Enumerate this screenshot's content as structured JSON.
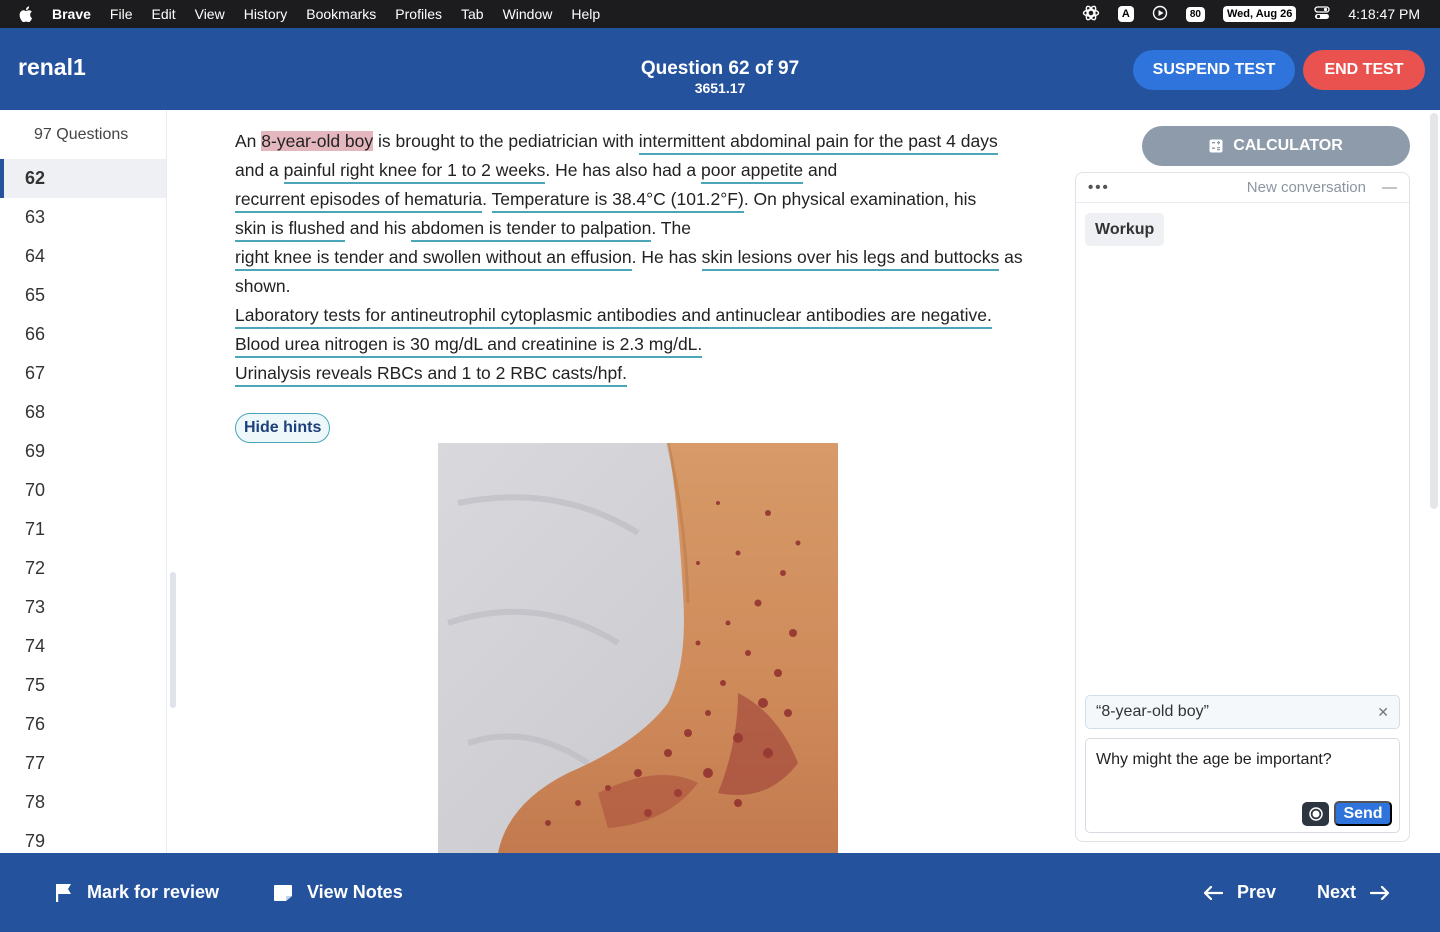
{
  "menubar": {
    "app": "Brave",
    "items": [
      "File",
      "Edit",
      "View",
      "History",
      "Bookmarks",
      "Profiles",
      "Tab",
      "Window",
      "Help"
    ],
    "input_indicator": "A",
    "battery": "80",
    "date": "Wed, Aug 26",
    "time": "4:18:47 PM"
  },
  "header": {
    "title": "renal1",
    "question_label": "Question 62 of 97",
    "timer": "3651.17",
    "suspend_label": "SUSPEND TEST",
    "end_label": "END TEST"
  },
  "sidebar": {
    "count_label": "97 Questions",
    "active": "62",
    "items": [
      "62",
      "63",
      "64",
      "65",
      "66",
      "67",
      "68",
      "69",
      "70",
      "71",
      "72",
      "73",
      "74",
      "75",
      "76",
      "77",
      "78",
      "79"
    ]
  },
  "question": {
    "l1": {
      "a": "An ",
      "hl": "8-year-old boy",
      "b": " is brought to the pediatrician with ",
      "u1": "intermittent abdominal pain for the past 4 days"
    },
    "l2": {
      "a": "and a ",
      "u1": "painful right knee for 1 to 2 weeks",
      "b": ". He has also had a ",
      "u2": "poor appetite",
      "c": " and"
    },
    "l3": {
      "u1": "recurrent episodes of hematuria",
      "a": ". ",
      "u2": "Temperature is 38.4°C (101.2°F)",
      "b": ". On physical examination, his"
    },
    "l4": {
      "u1": "skin is flushed",
      "a": " and his ",
      "u2": "abdomen is tender to palpation",
      "b": ". The"
    },
    "l5": {
      "u1": "right knee is tender and swollen without an effusion",
      "a": ". He has ",
      "u2": "skin lesions over his legs and buttocks",
      "b": " as"
    },
    "l6": "shown.",
    "l7": "Laboratory tests for antineutrophil cytoplasmic antibodies and antinuclear antibodies are negative.",
    "l8": "Blood urea nitrogen is 30 mg/dL and creatinine is 2.3 mg/dL.",
    "l9": "Urinalysis reveals RBCs and 1 to 2 RBC casts/hpf."
  },
  "hints_label": "Hide hints",
  "calculator_label": "CALCULATOR",
  "chat": {
    "new_conversation": "New conversation",
    "chip": "Workup",
    "quote": "“8-year-old boy”",
    "input_value": "Why might the age be important?",
    "send_label": "Send"
  },
  "footer": {
    "mark_label": "Mark for review",
    "notes_label": "View Notes",
    "prev_label": "Prev",
    "next_label": "Next"
  }
}
